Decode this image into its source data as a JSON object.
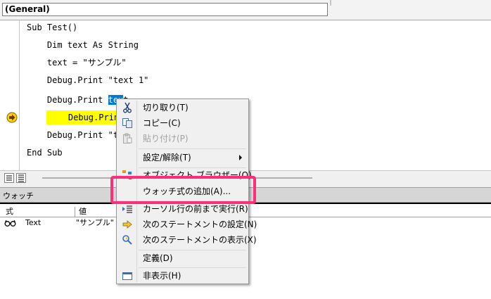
{
  "code_window": {
    "object_combo_value": "(General)",
    "lines": [
      "Sub Test()",
      "    Dim text As String",
      "    text = \"サンプル\"",
      "    Debug.Print \"text 1\"",
      "    Debug.Print ",
      "    Debug.Print \"t",
      "    Debug.Print \"t",
      "End Sub"
    ],
    "selected_word": "tex",
    "selected_word_tail": "t",
    "current_line_index": 5
  },
  "watch": {
    "title": "ウォッチ",
    "columns": {
      "expression": "式",
      "value": "値"
    },
    "rows": [
      {
        "expression": "Text",
        "value": "\"サンプル\""
      }
    ]
  },
  "context_menu": {
    "items": [
      {
        "label": "切り取り(T)",
        "icon": "scissors-icon",
        "enabled": true
      },
      {
        "label": "コピー(C)",
        "icon": "copy-icon",
        "enabled": true
      },
      {
        "label": "貼り付け(P)",
        "icon": "paste-icon",
        "enabled": false
      },
      {
        "label": "設定/解除(T)",
        "icon": "",
        "enabled": true,
        "submenu": true
      },
      {
        "label": "オブジェクト ブラウザー(O)",
        "icon": "object-browser-icon",
        "enabled": true
      },
      {
        "label": "ウォッチ式の追加(A)...",
        "icon": "",
        "enabled": true
      },
      {
        "label": "カーソル行の前まで実行(R)",
        "icon": "run-to-cursor-icon",
        "enabled": true
      },
      {
        "label": "次のステートメントの設定(N)",
        "icon": "arrow-right-icon",
        "enabled": true
      },
      {
        "label": "次のステートメントの表示(X)",
        "icon": "show-next-statement-icon",
        "enabled": true
      },
      {
        "label": "定義(D)",
        "icon": "",
        "enabled": true
      },
      {
        "label": "非表示(H)",
        "icon": "window-icon",
        "enabled": true
      }
    ]
  },
  "colors": {
    "highlight_border": "#ff2d7a",
    "execution_line": "#ffff00",
    "breakpoint": "#800000",
    "selection": "#0078d7"
  }
}
